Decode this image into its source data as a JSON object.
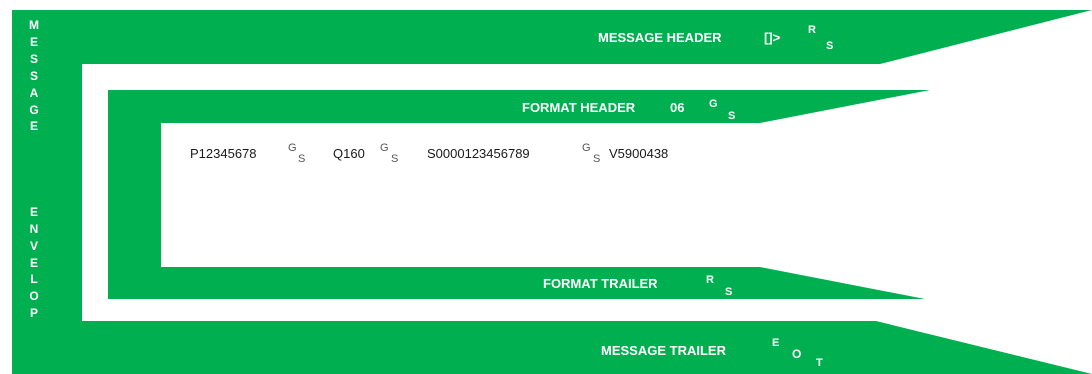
{
  "colors": {
    "envelope_green": "#00b050",
    "inner_background": "#ffffff",
    "label_text": "#ffffff",
    "data_text": "#1a1a1a"
  },
  "envelope": {
    "vertical_label_top": [
      "M",
      "E",
      "S",
      "S",
      "A",
      "G",
      "E"
    ],
    "vertical_label_bottom": [
      "E",
      "N",
      "V",
      "E",
      "L",
      "O",
      "P"
    ]
  },
  "message_header": {
    "label": "MESSAGE HEADER",
    "code": "[]>",
    "sep_sup": "R",
    "sep_sub": "S"
  },
  "format_header": {
    "label": "FORMAT HEADER",
    "code": "06",
    "sep_sup": "G",
    "sep_sub": "S"
  },
  "data_line": {
    "segments": [
      {
        "text": "P12345678",
        "sep_sup": "G",
        "sep_sub": "S"
      },
      {
        "text": "Q160",
        "sep_sup": "G",
        "sep_sub": "S"
      },
      {
        "text": "S0000123456789",
        "sep_sup": "G",
        "sep_sub": "S"
      },
      {
        "text": "V5900438",
        "sep_sup": "",
        "sep_sub": ""
      }
    ]
  },
  "format_trailer": {
    "label": "FORMAT TRAILER",
    "sep_sup": "R",
    "sep_sub": "S"
  },
  "message_trailer": {
    "label": "MESSAGE TRAILER",
    "sep_sup": "E",
    "sep_mid": "O",
    "sep_sub": "T"
  }
}
